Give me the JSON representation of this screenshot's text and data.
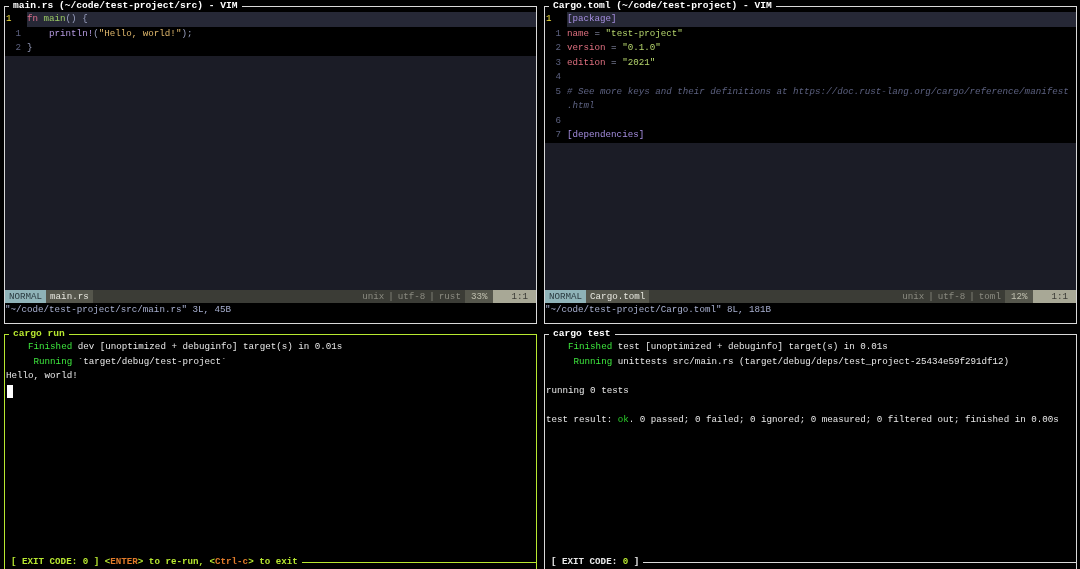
{
  "panes": [
    {
      "kind": "editor",
      "title": "main.rs (~/code/test-project/src) - VIM",
      "focused": false,
      "lines": [
        {
          "number": "1",
          "current": true,
          "tokens": [
            {
              "text": "fn",
              "kind": "keyword"
            },
            {
              "text": " main",
              "kind": "function"
            },
            {
              "text": "() {",
              "kind": "punct"
            }
          ]
        },
        {
          "number": "1",
          "current": false,
          "tokens": [
            {
              "text": "    println!",
              "kind": "macro"
            },
            {
              "text": "(",
              "kind": "punct"
            },
            {
              "text": "\"Hello, world!\"",
              "kind": "string"
            },
            {
              "text": ");",
              "kind": "punct"
            }
          ]
        },
        {
          "number": "2",
          "current": false,
          "tokens": [
            {
              "text": "}",
              "kind": "punct"
            }
          ]
        }
      ],
      "status": {
        "mode": "NORMAL",
        "file": "main.rs",
        "format": "unix",
        "encoding": "utf-8",
        "filetype": "rust",
        "separators": [
          "|",
          "|"
        ],
        "percent": "33%",
        "position": "1:1"
      },
      "message": "\"~/code/test-project/src/main.rs\" 3L, 45B"
    },
    {
      "kind": "editor",
      "title": "Cargo.toml (~/code/test-project) - VIM",
      "focused": false,
      "lines": [
        {
          "number": "1",
          "current": true,
          "tokens": [
            {
              "text": "[package]",
              "kind": "section"
            }
          ]
        },
        {
          "number": "1",
          "current": false,
          "tokens": [
            {
              "text": "name",
              "kind": "key"
            },
            {
              "text": " = ",
              "kind": "punct"
            },
            {
              "text": "\"test-project\"",
              "kind": "value"
            }
          ]
        },
        {
          "number": "2",
          "current": false,
          "tokens": [
            {
              "text": "version",
              "kind": "key"
            },
            {
              "text": " = ",
              "kind": "punct"
            },
            {
              "text": "\"0.1.0\"",
              "kind": "value"
            }
          ]
        },
        {
          "number": "3",
          "current": false,
          "tokens": [
            {
              "text": "edition",
              "kind": "key"
            },
            {
              "text": " = ",
              "kind": "punct"
            },
            {
              "text": "\"2021\"",
              "kind": "value"
            }
          ]
        },
        {
          "number": "4",
          "current": false
        },
        {
          "number": "5",
          "current": false,
          "tokens": [
            {
              "text": "# See more keys and their definitions at https://doc.rust-lang.org/cargo/reference/manifest",
              "kind": "comment"
            }
          ]
        },
        {
          "current": false,
          "tokens": [
            {
              "text": ".html",
              "kind": "comment"
            }
          ]
        },
        {
          "number": "6",
          "current": false
        },
        {
          "number": "7",
          "current": false,
          "tokens": [
            {
              "text": "[dependencies]",
              "kind": "section"
            }
          ]
        }
      ],
      "status": {
        "mode": "NORMAL",
        "file": "Cargo.toml",
        "format": "unix",
        "encoding": "utf-8",
        "filetype": "toml",
        "separators": [
          "|",
          "|"
        ],
        "percent": "12%",
        "position": "1:1"
      },
      "message": "\"~/code/test-project/Cargo.toml\" 8L, 181B"
    },
    {
      "kind": "terminal",
      "title": "cargo run",
      "focused": true,
      "lines": [
        {
          "kind": "text",
          "tokens": [
            {
              "text": "    Finished",
              "kind": "label"
            },
            {
              "text": " dev [unoptimized + debuginfo] target(s) in 0.01s",
              "kind": "plain"
            }
          ]
        },
        {
          "kind": "text",
          "tokens": [
            {
              "text": "     Running",
              "kind": "label"
            },
            {
              "text": " `target/debug/test-project`",
              "kind": "plain"
            }
          ]
        },
        {
          "kind": "text",
          "tokens": [
            {
              "text": "Hello, world!",
              "kind": "plain"
            }
          ]
        },
        {
          "kind": "cursor"
        }
      ],
      "footer": [
        {
          "text": "[ EXIT CODE: ",
          "kind": "plain"
        },
        {
          "text": "0",
          "kind": "success"
        },
        {
          "text": " ] <",
          "kind": "plain"
        },
        {
          "text": "ENTER",
          "kind": "key"
        },
        {
          "text": "> to re-run, <",
          "kind": "plain"
        },
        {
          "text": "Ctrl-c",
          "kind": "key"
        },
        {
          "text": "> to exit",
          "kind": "plain"
        }
      ]
    },
    {
      "kind": "terminal",
      "title": "cargo test",
      "focused": false,
      "lines": [
        {
          "kind": "text",
          "tokens": [
            {
              "text": "    Finished",
              "kind": "label"
            },
            {
              "text": " test [unoptimized + debuginfo] target(s) in 0.01s",
              "kind": "plain"
            }
          ]
        },
        {
          "kind": "text",
          "tokens": [
            {
              "text": "     Running",
              "kind": "label"
            },
            {
              "text": " unittests src/main.rs (target/debug/deps/test_project-25434e59f291df12)",
              "kind": "plain"
            }
          ]
        },
        {
          "kind": "blank"
        },
        {
          "kind": "text",
          "tokens": [
            {
              "text": "running 0 tests",
              "kind": "plain"
            }
          ]
        },
        {
          "kind": "blank"
        },
        {
          "kind": "text",
          "tokens": [
            {
              "text": "test result: ",
              "kind": "plain"
            },
            {
              "text": "ok",
              "kind": "ok"
            },
            {
              "text": ". 0 passed; 0 failed; 0 ignored; 0 measured; 0 filtered out; finished in 0.00s",
              "kind": "plain"
            }
          ]
        }
      ],
      "footer": [
        {
          "text": "[ EXIT CODE: ",
          "kind": "plain"
        },
        {
          "text": "0",
          "kind": "success"
        },
        {
          "text": " ]",
          "kind": "plain"
        }
      ]
    }
  ]
}
